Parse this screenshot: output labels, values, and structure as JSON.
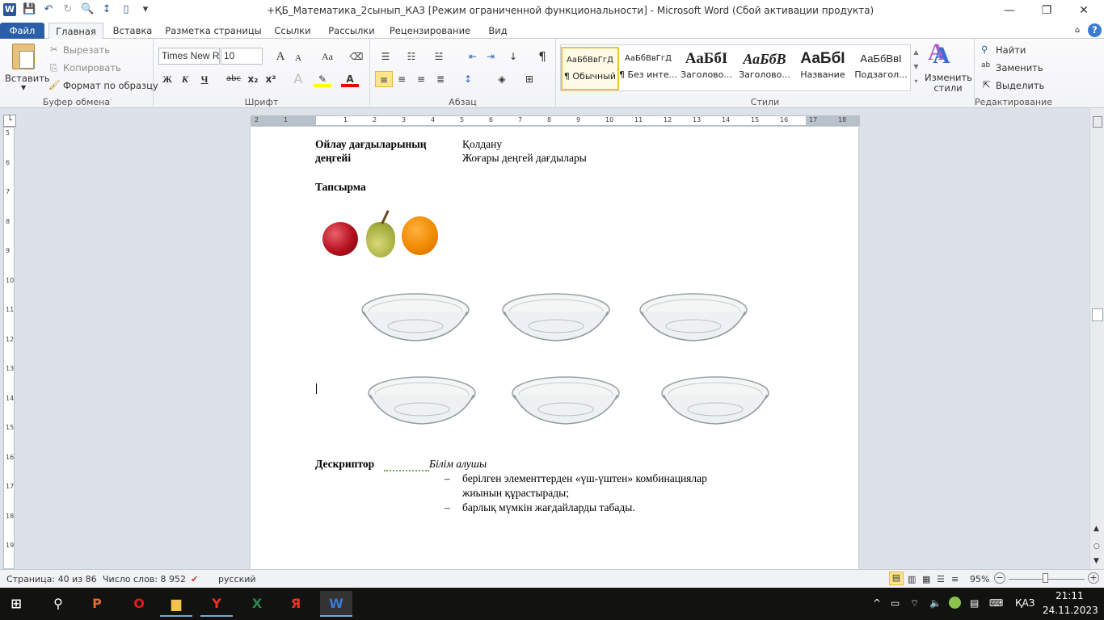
{
  "window": {
    "title": "+ҚБ_Математика_2сынып_КАЗ [Режим ограниченной функциональности]  -  Microsoft Word (Сбой активации продукта)",
    "minimize": "—",
    "restore": "❐",
    "close": "✕"
  },
  "quick_access": {
    "logo": "W",
    "save": "💾",
    "undo": "↶",
    "redo": "↻",
    "preview": "🔍",
    "spacing": "↕",
    "new": "▯",
    "customize": "▾"
  },
  "tabs": [
    "Файл",
    "Главная",
    "Вставка",
    "Разметка страницы",
    "Ссылки",
    "Рассылки",
    "Рецензирование",
    "Вид"
  ],
  "help": "?",
  "clipboard": {
    "paste": "Вставить",
    "cut": "Вырезать",
    "copy": "Копировать",
    "format_painter": "Формат по образцу",
    "label": "Буфер обмена"
  },
  "font": {
    "name": "Times New Rc",
    "size": "10",
    "grow": "A",
    "shrink": "A",
    "case": "Aa",
    "bold": "Ж",
    "italic": "К",
    "underline": "Ч",
    "strike": "abc",
    "sub": "x₂",
    "sup": "x²",
    "label": "Шрифт"
  },
  "paragraph": {
    "label": "Абзац",
    "pilcrow": "¶"
  },
  "styles": {
    "items": [
      {
        "sample": "АаБбВвГгД",
        "name": "¶ Обычный"
      },
      {
        "sample": "АаБбВвГгД",
        "name": "¶ Без инте..."
      },
      {
        "sample": "АаБбІ",
        "name": "Заголово..."
      },
      {
        "sample": "АаБбВ",
        "name": "Заголово..."
      },
      {
        "sample": "АаБбІ",
        "name": "Название"
      },
      {
        "sample": "АаБбВвІ",
        "name": "Подзагол..."
      }
    ],
    "change": "Изменить стили",
    "label": "Стили"
  },
  "editing": {
    "find": "Найти",
    "replace": "Заменить",
    "select": "Выделить",
    "label": "Редактирование"
  },
  "ruler": {
    "h": [
      "2",
      "1",
      "1",
      "2",
      "3",
      "4",
      "5",
      "6",
      "7",
      "8",
      "9",
      "10",
      "11",
      "12",
      "13",
      "14",
      "15",
      "16",
      "17",
      "18"
    ],
    "v": [
      "5",
      "6",
      "7",
      "8",
      "9",
      "10",
      "11",
      "12",
      "13",
      "14",
      "15",
      "16",
      "17",
      "18",
      "19"
    ]
  },
  "document": {
    "row_label_1": "Ойлау дағдыларының",
    "row_label_2": "деңгейі",
    "row_value_1": "Қолдану",
    "row_value_2": "Жоғары деңгей дағдылары",
    "task": "Тапсырма",
    "descriptor": "Дескриптор",
    "learner": "Білім алушы",
    "bullets": [
      "берілген элементтерден «үш-үштен» комбинациялар",
      "жиынын құрастырады;",
      "барлық мүмкін жағдайларды табады."
    ],
    "dash": "–"
  },
  "status": {
    "page": "Страница: 40 из 86",
    "words": "Число слов: 8 952",
    "lang": "русский",
    "zoom": "95%",
    "zoom_level": 95
  },
  "taskbar": {
    "lang": "ҚАЗ",
    "time": "21:11",
    "date": "24.11.2023"
  }
}
